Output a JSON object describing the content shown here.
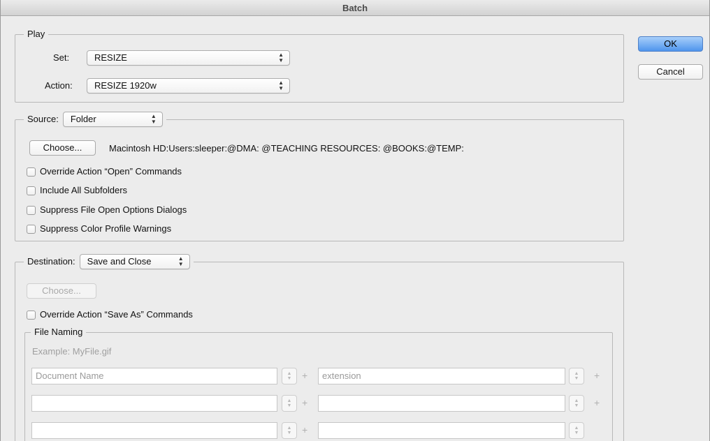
{
  "window": {
    "title": "Batch"
  },
  "play": {
    "legend": "Play",
    "set_label": "Set:",
    "set_value": "RESIZE",
    "action_label": "Action:",
    "action_value": "RESIZE 1920w"
  },
  "buttons": {
    "ok": "OK",
    "cancel": "Cancel"
  },
  "source": {
    "legend": "Source:",
    "value": "Folder",
    "choose_label": "Choose...",
    "path": "Macintosh HD:Users:sleeper:@DMA: @TEACHING RESOURCES: @BOOKS:@TEMP:",
    "options": [
      "Override Action “Open” Commands",
      "Include All Subfolders",
      "Suppress File Open Options Dialogs",
      "Suppress Color Profile Warnings"
    ]
  },
  "destination": {
    "legend": "Destination:",
    "value": "Save and Close",
    "choose_label": "Choose...",
    "override_label": "Override Action “Save As” Commands",
    "file_naming": {
      "legend": "File Naming",
      "example": "Example: MyFile.gif",
      "rows": [
        [
          "Document Name",
          "extension"
        ],
        [
          "",
          ""
        ],
        [
          "",
          ""
        ]
      ]
    }
  }
}
